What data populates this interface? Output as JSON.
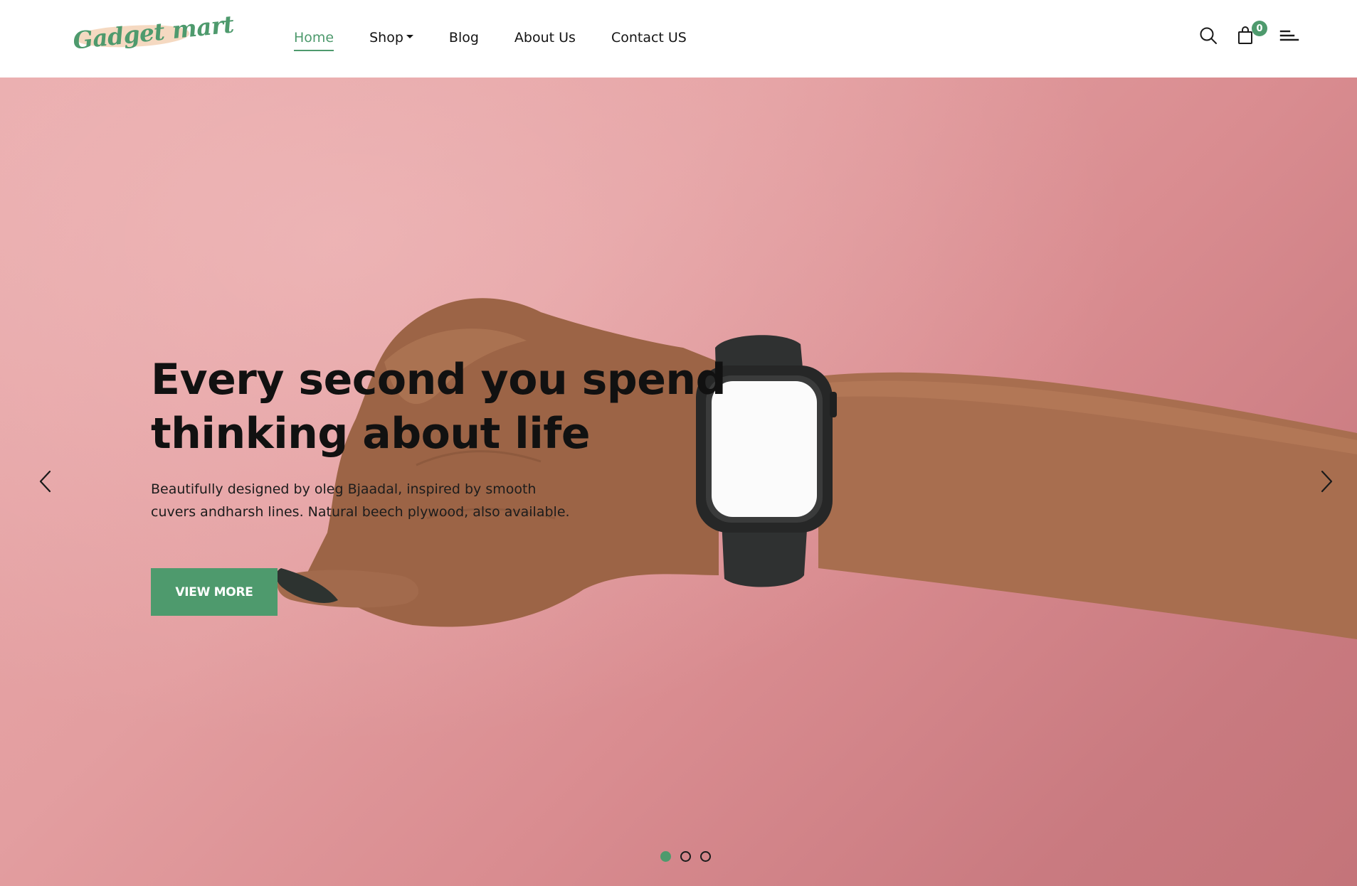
{
  "brand": {
    "logo_text": "Gadget mart",
    "accent_color": "#4e9a6d",
    "logo_brush_color": "#f3d2b6"
  },
  "nav": {
    "items": [
      {
        "label": "Home",
        "active": true
      },
      {
        "label": "Shop",
        "has_dropdown": true
      },
      {
        "label": "Blog"
      },
      {
        "label": "About Us"
      },
      {
        "label": "Contact US"
      }
    ]
  },
  "header_icons": {
    "search": "search-icon",
    "cart": "shopping-bag-icon",
    "cart_count": "0",
    "menu": "menu-icon"
  },
  "hero": {
    "title_line1": "Every second you spend",
    "title_line2": "thinking about life",
    "desc_line1": "Beautifully designed by oleg Bjaadal, inspired by smooth",
    "desc_line2": "cuvers andharsh lines. Natural beech plywood, also available.",
    "button_label": "VIEW MORE",
    "background_color": "#e39ea0",
    "slides_total": 3,
    "active_slide": 1
  },
  "carousel": {
    "prev": "chevron-left-icon",
    "next": "chevron-right-icon"
  }
}
